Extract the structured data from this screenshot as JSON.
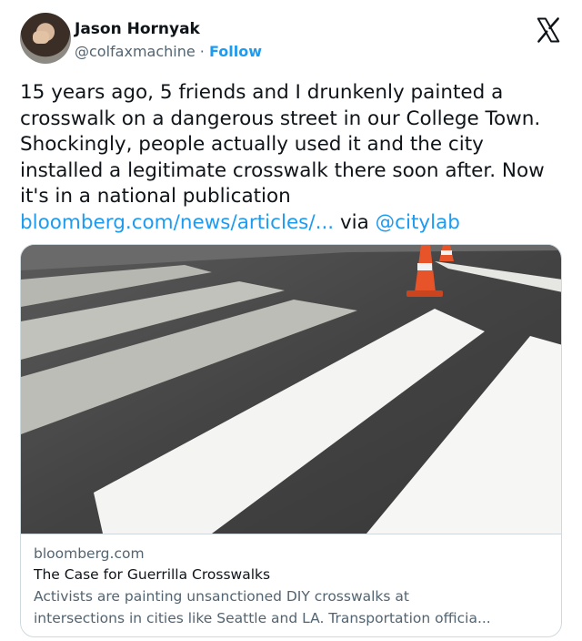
{
  "author": {
    "name": "Jason Hornyak",
    "handle": "@colfaxmachine",
    "separator": " · ",
    "follow_label": "Follow"
  },
  "tweet": {
    "text": "15 years ago, 5 friends and I drunkenly painted a crosswalk on a dangerous street in our College Town. Shockingly, people actually used it and the city  installed a legitimate crosswalk there soon after. Now it's in a national publication ",
    "link_text": "bloomberg.com/news/articles/...",
    "via_text": " via ",
    "mention": "@citylab"
  },
  "card": {
    "domain": "bloomberg.com",
    "title": "The Case for Guerrilla Crosswalks",
    "description_line1": "Activists are painting unsanctioned DIY crosswalks at",
    "description_line2": "intersections in cities like Seattle and LA. Transportation officia..."
  },
  "colors": {
    "link": "#1d9bf0",
    "secondary_text": "#536471",
    "primary_text": "#0f1419",
    "border": "#cfd9de",
    "asphalt": "#3d3d3d",
    "cone": "#e8542a"
  },
  "icons": [
    "x-logo-icon",
    "avatar"
  ]
}
